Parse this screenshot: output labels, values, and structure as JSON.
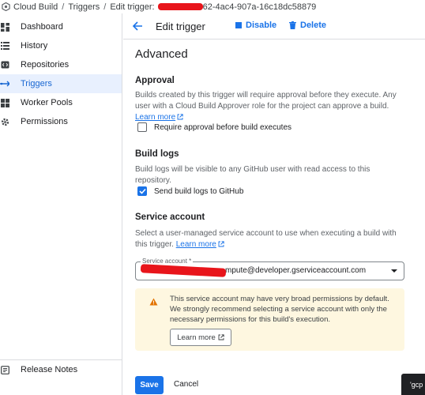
{
  "breadcrumb": {
    "root": "Cloud Build",
    "section": "Triggers",
    "page_prefix": "Edit trigger:",
    "trigger_id_visible": "62-4ac4-907a-16c18dc58879"
  },
  "sidebar": {
    "items": [
      {
        "label": "Dashboard",
        "icon": "dashboard-icon"
      },
      {
        "label": "History",
        "icon": "history-icon"
      },
      {
        "label": "Repositories",
        "icon": "repositories-icon"
      },
      {
        "label": "Triggers",
        "icon": "triggers-icon",
        "active": true
      },
      {
        "label": "Worker Pools",
        "icon": "worker-pools-icon"
      },
      {
        "label": "Permissions",
        "icon": "gear-icon"
      }
    ],
    "footer_item": {
      "label": "Release Notes",
      "icon": "release-notes-icon"
    }
  },
  "header": {
    "title": "Edit trigger",
    "disable_label": "Disable",
    "delete_label": "Delete"
  },
  "main": {
    "title": "Advanced",
    "approval": {
      "title": "Approval",
      "desc": "Builds created by this trigger will require approval before they execute. Any user with a Cloud Build Approver role for the project can approve a build.",
      "learn_more": "Learn more",
      "checkbox_label": "Require approval before build executes",
      "checked": false
    },
    "build_logs": {
      "title": "Build logs",
      "desc": "Build logs will be visible to any GitHub user with read access to this repository.",
      "checkbox_label": "Send build logs to GitHub",
      "checked": true
    },
    "service_account": {
      "title": "Service account",
      "desc": "Select a user-managed service account to use when executing a build with this trigger.",
      "learn_more": "Learn more",
      "field_label": "Service account *",
      "field_value_visible": "mpute@developer.gserviceaccount.com"
    },
    "warning": {
      "text": "This service account may have very broad permissions by default. We strongly recommend selecting a service account with only the necessary permissions for this build's execution.",
      "button": "Learn more"
    },
    "save_label": "Save",
    "cancel_label": "Cancel"
  },
  "tooltip_chip": "'gcp",
  "colors": {
    "accent": "#1a73e8",
    "active_bg": "#e8f0fe",
    "warning_bg": "#fef7e0",
    "warning_icon": "#e37400",
    "redaction": "#e8151b"
  }
}
